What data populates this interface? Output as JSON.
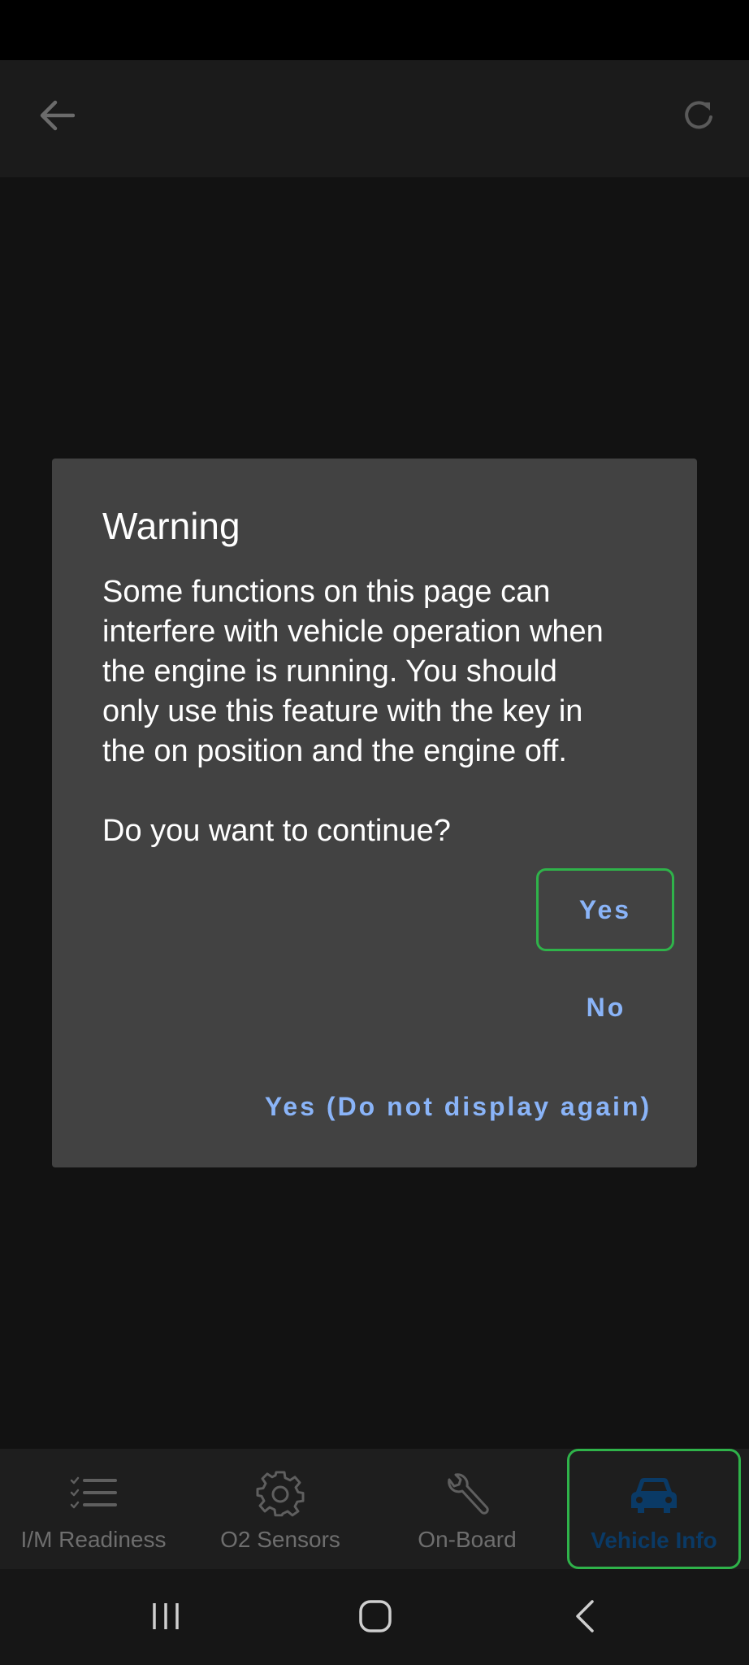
{
  "app_bar": {
    "back_icon": "arrow-left-icon",
    "refresh_icon": "refresh-icon"
  },
  "dialog": {
    "title": "Warning",
    "message": "Some functions on this page can\ninterfere with vehicle operation when\nthe engine is running. You should\nonly use this feature with the key in\nthe on position and the engine off.\n\nDo you want to continue?",
    "yes_label": "Yes",
    "no_label": "No",
    "yes_no_display_label": "Yes (Do not display again)",
    "button_text_color": "#8ab4f8",
    "focus_outline_color": "#2fb34a"
  },
  "bottom_nav": {
    "items": [
      {
        "label": "I/M Readiness",
        "icon": "checklist-icon"
      },
      {
        "label": "O2 Sensors",
        "icon": "gear-icon"
      },
      {
        "label": "On-Board",
        "icon": "wrench-icon"
      },
      {
        "label": "Vehicle Info",
        "icon": "car-icon",
        "selected": true
      }
    ],
    "selected_color": "#0a3a66"
  },
  "system_nav": {
    "recents_icon": "recents-icon",
    "home_icon": "home-icon",
    "back_icon": "chevron-left-icon"
  }
}
